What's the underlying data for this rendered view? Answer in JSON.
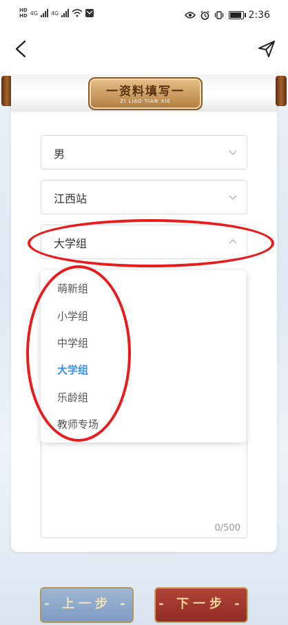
{
  "status_bar": {
    "time": "2:36",
    "network_left_top": "HD",
    "network_left_bottom": "HD",
    "signal_label_1": "4G",
    "signal_label_2": "4G"
  },
  "nav": {
    "back_icon": "chevron-left-icon",
    "share_icon": "send-paper-plane-icon"
  },
  "header": {
    "title": "一资料填写一",
    "subtitle": "ZI LIAO TIAN XIE"
  },
  "form": {
    "gender": {
      "value": "男"
    },
    "station": {
      "value": "江西站"
    },
    "group": {
      "value": "大学组"
    },
    "textarea_counter": "0/500"
  },
  "dropdown": {
    "options": [
      {
        "label": "萌新组",
        "selected": false
      },
      {
        "label": "小学组",
        "selected": false
      },
      {
        "label": "中学组",
        "selected": false
      },
      {
        "label": "大学组",
        "selected": true
      },
      {
        "label": "乐龄组",
        "selected": false
      },
      {
        "label": "教师专场",
        "selected": false
      }
    ]
  },
  "buttons": {
    "prev": "- 上一步 -",
    "next": "- 下一步 -"
  },
  "colors": {
    "selected_option": "#3d8ee6",
    "annotation_red": "#ea1b1b",
    "next_button": "#9e352d",
    "prev_button": "#8ea8cb"
  }
}
